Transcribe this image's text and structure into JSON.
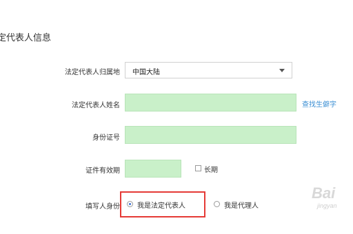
{
  "section": {
    "title": "定代表人信息"
  },
  "form": {
    "region": {
      "label": "法定代表人归属地",
      "value": "中国大陆"
    },
    "name": {
      "label": "法定代表人姓名",
      "value": "",
      "link": "查找生僻字"
    },
    "id_number": {
      "label": "身份证号",
      "value": ""
    },
    "validity": {
      "label": "证件有效期",
      "value": "",
      "long_term_label": "长期",
      "long_term_checked": false
    },
    "identity": {
      "label": "填写人身份",
      "options": [
        {
          "label": "我是法定代表人",
          "selected": true
        },
        {
          "label": "我是代理人",
          "selected": false
        }
      ]
    }
  },
  "watermark": {
    "text": "Bai",
    "sub": "jingyan"
  },
  "colors": {
    "field_bg": "#c9f0c9",
    "link": "#3b8fd4",
    "highlight": "#e53935"
  }
}
